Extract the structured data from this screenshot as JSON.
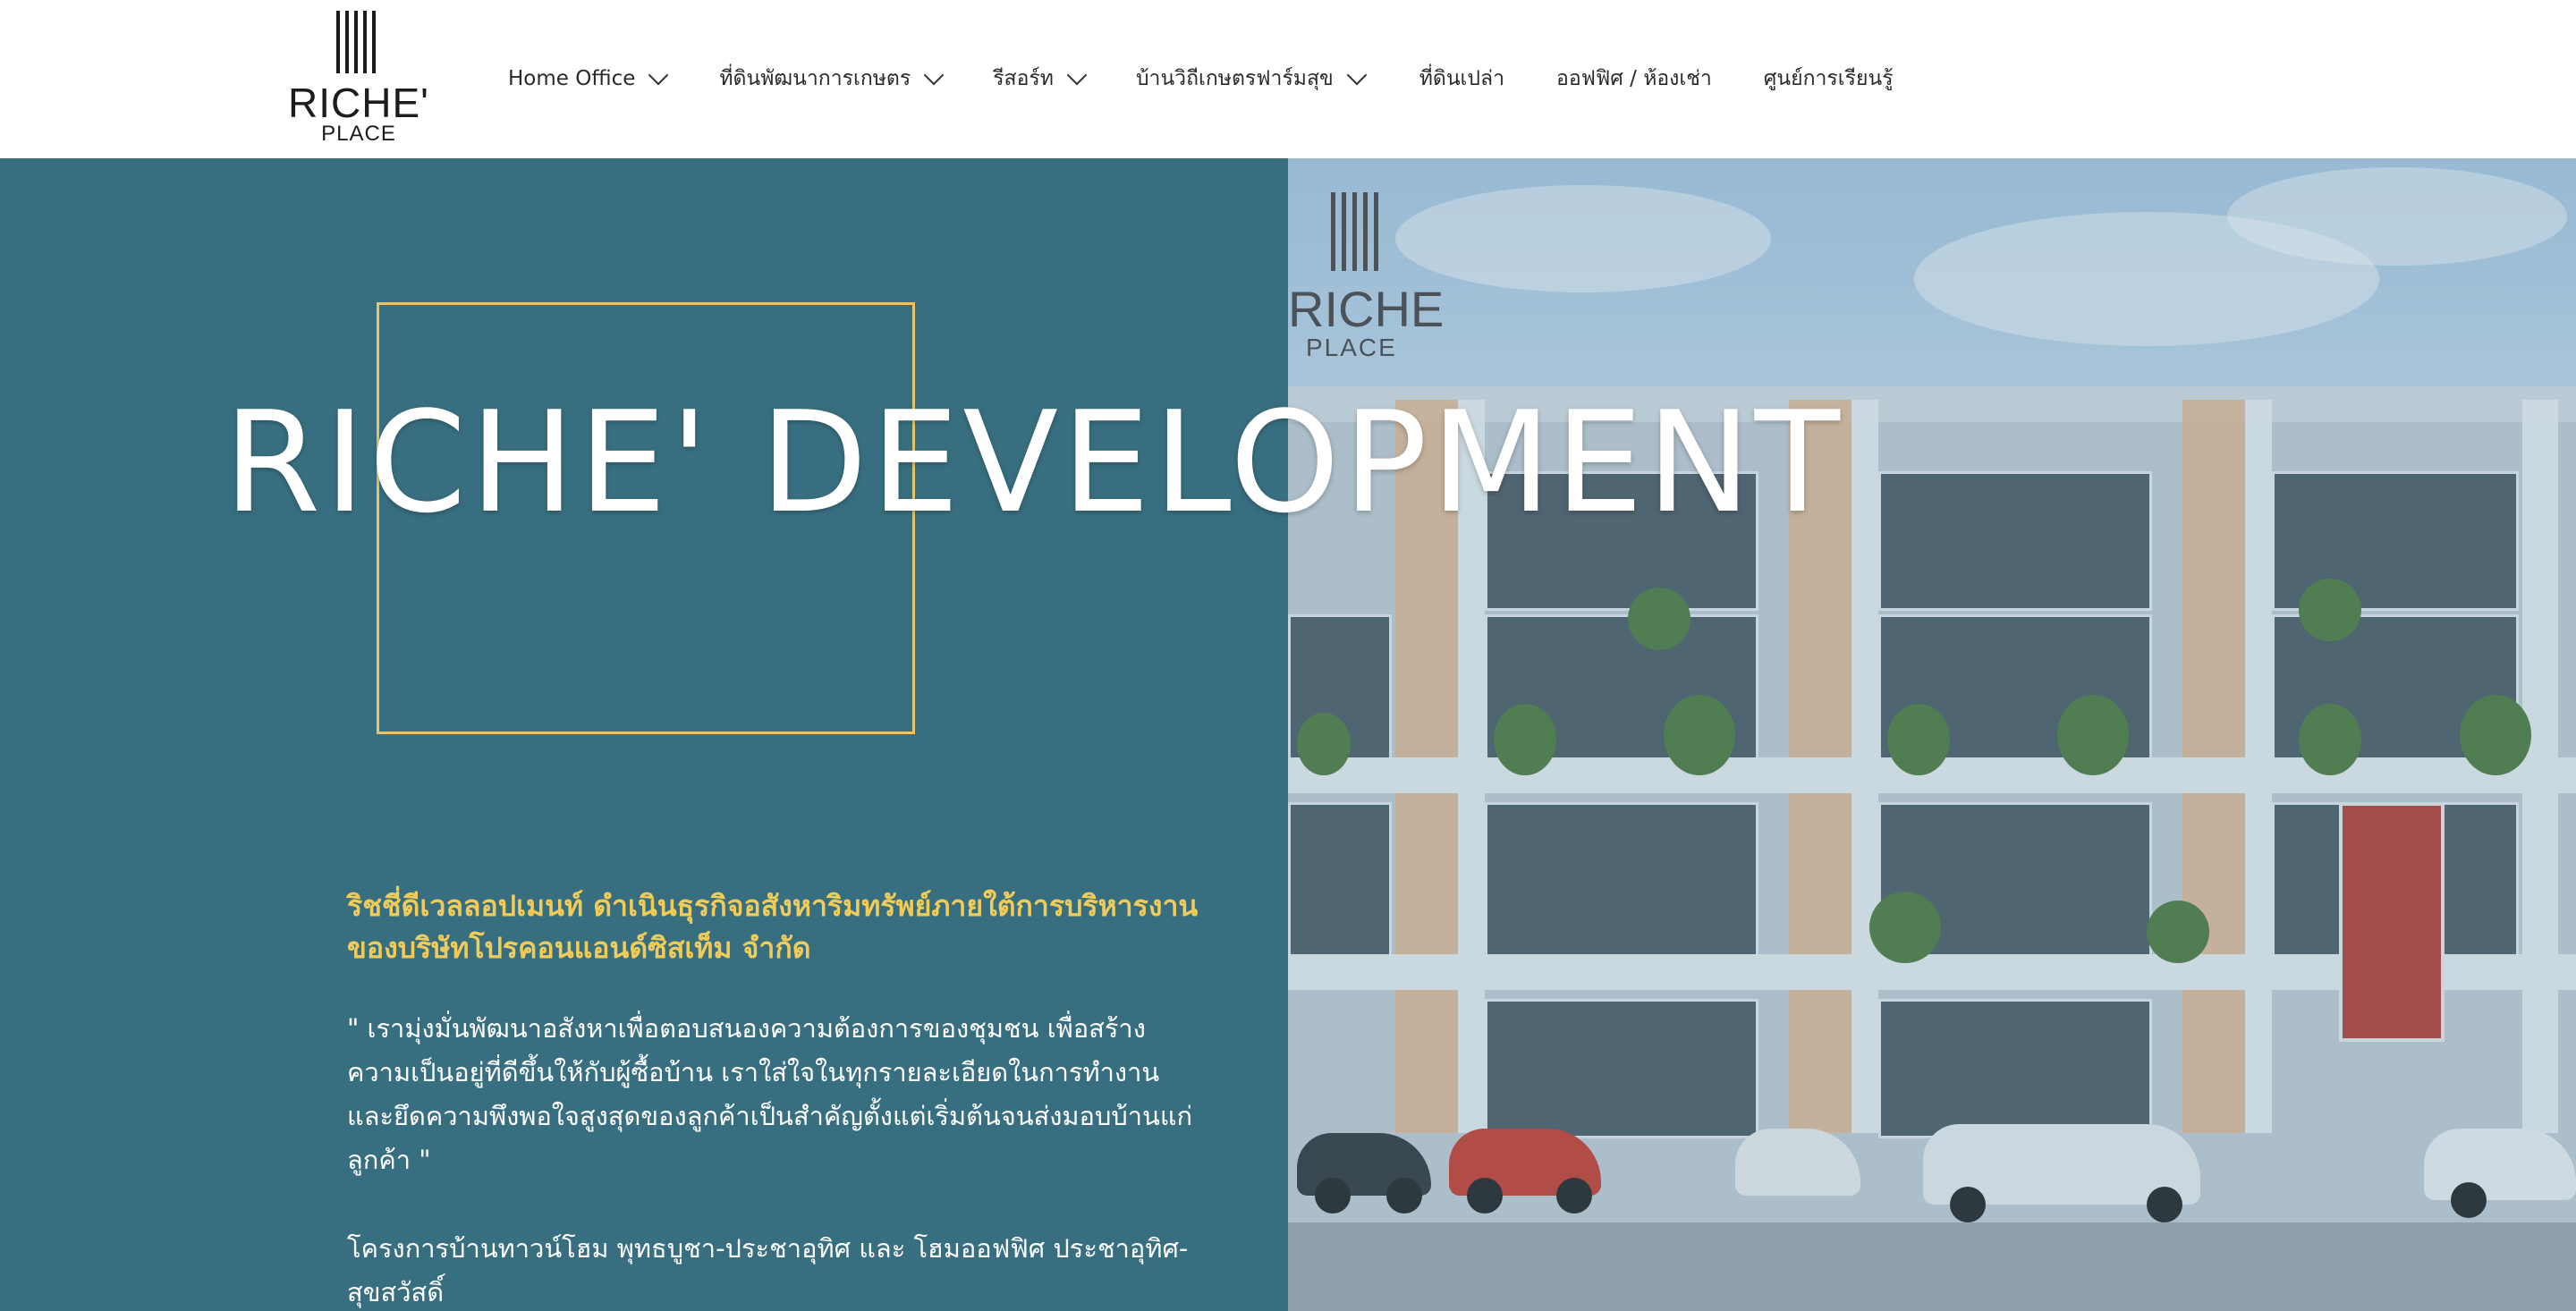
{
  "logo": {
    "word": "RICHE'",
    "sub": "PLACE"
  },
  "nav": {
    "items": [
      {
        "label": "Home Office",
        "dropdown": true
      },
      {
        "label": "ที่ดินพัฒนาการเกษตร",
        "dropdown": true
      },
      {
        "label": "รีสอร์ท",
        "dropdown": true
      },
      {
        "label": "บ้านวิถีเกษตรฟาร์มสุข",
        "dropdown": true
      },
      {
        "label": "ที่ดินเปล่า",
        "dropdown": false
      },
      {
        "label": "ออฟฟิศ / ห้องเช่า",
        "dropdown": false
      },
      {
        "label": "ศูนย์การเรียนรู้",
        "dropdown": false
      }
    ]
  },
  "hero": {
    "title": "RICHE' DEVELOPMENT",
    "image_logo": {
      "word": "RICHE",
      "sub": "PLACE"
    },
    "subhead": "ริชชี่ดีเวลลอปเมนท์ ดำเนินธุรกิจอสังหาริมทรัพย์ภายใต้การบริหารงานของบริษัทโปรคอนแอนด์ซิสเท็ม จำกัด",
    "quote": " \" เรามุ่งมั่นพัฒนาอสังหาเพื่อตอบสนองความต้องการของชุมชน เพื่อสร้างความเป็นอยู่ที่ดีขึ้นให้กับผู้ซื้อบ้าน เราใส่ใจในทุกรายละเอียดในการทำงานและยึดความพึงพอใจสูงสุดของลูกค้าเป็นสำคัญตั้งแต่เริ่มต้นจนส่งมอบบ้านแก่ลูกค้า \"",
    "projects": "โครงการบ้านทาวน์โฮม พุทธบูชา-ประชาอุทิศ และ โฮมออฟฟิศ ประชาอุทิศ-สุขสวัสดิ์"
  },
  "colors": {
    "panel": "#386f80",
    "accent_gold": "#e5c46c",
    "subhead_gold": "#f1cb58",
    "text": "#ffffff"
  }
}
